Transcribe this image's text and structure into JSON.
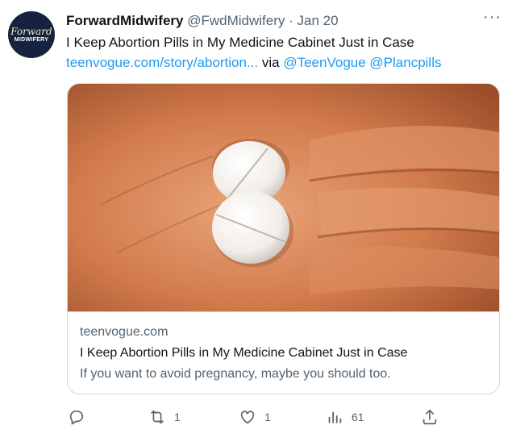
{
  "tweet": {
    "display_name": "ForwardMidwifery",
    "handle": "@FwdMidwifery",
    "separator": "·",
    "date": "Jan 20",
    "text": "I Keep Abortion Pills in My Medicine Cabinet Just in Case",
    "link_text": "teenvogue.com/story/abortion...",
    "via_text": "via",
    "mention_1": "@TeenVogue",
    "mention_2": "@Plancpills",
    "avatar": {
      "script_text": "Forward",
      "caps_text": "MIDWIFERY"
    }
  },
  "more_menu": {
    "icon": "more-dots-icon",
    "label": "···"
  },
  "card": {
    "domain": "teenvogue.com",
    "title": "I Keep Abortion Pills in My Medicine Cabinet Just in Case",
    "description": "If you want to avoid pregnancy, maybe you should too.",
    "image_subject": "hand-holding-two-white-pills"
  },
  "actions": {
    "reply": {
      "icon": "reply-icon",
      "count": ""
    },
    "retweet": {
      "icon": "retweet-icon",
      "count": "1"
    },
    "like": {
      "icon": "heart-icon",
      "count": "1"
    },
    "views": {
      "icon": "views-icon",
      "count": "61"
    },
    "share": {
      "icon": "share-icon",
      "count": ""
    }
  },
  "colors": {
    "link_blue": "#1d9bf0",
    "secondary_text": "#536471",
    "primary_text": "#0f1419",
    "border": "#cfd9de",
    "avatar_bg": "#16233f"
  }
}
